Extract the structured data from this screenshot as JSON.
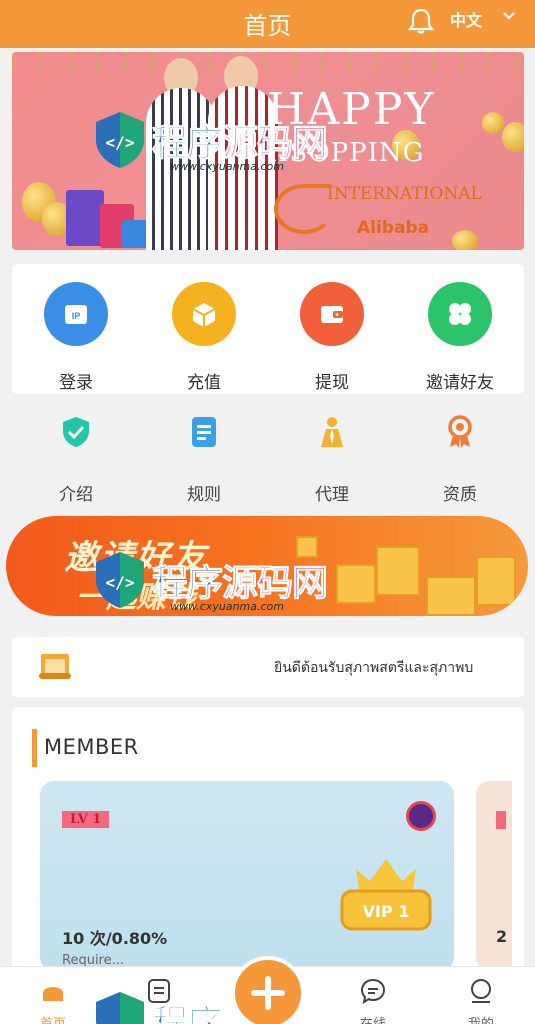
{
  "header": {
    "title": "首页",
    "language": "中文"
  },
  "banner": {
    "headline": "HAPPY",
    "subline": "IISOPPING",
    "international": "INTERNATIONAL",
    "brand": "Alibaba"
  },
  "main_actions": [
    {
      "label": "登录",
      "icon": "ip-icon",
      "color": "#3a8ee6"
    },
    {
      "label": "充值",
      "icon": "cube-icon",
      "color": "#f5b21e"
    },
    {
      "label": "提现",
      "icon": "wallet-icon",
      "color": "#f1603a"
    },
    {
      "label": "邀请好友",
      "icon": "clover-icon",
      "color": "#2bc46a"
    }
  ],
  "secondary_actions": [
    {
      "label": "介绍",
      "icon": "shield-check-icon"
    },
    {
      "label": "规则",
      "icon": "document-icon"
    },
    {
      "label": "代理",
      "icon": "agent-icon"
    },
    {
      "label": "资质",
      "icon": "award-icon"
    }
  ],
  "invite_banner": {
    "line1": "邀请好友",
    "line2": "一起赚钱"
  },
  "notice": {
    "message": "ยินดีต้อนรับสุภาพสตรีและสุภาพบ"
  },
  "member": {
    "title": "MEMBER",
    "cards": [
      {
        "tag": "LV 1",
        "badge": "VIP 1",
        "rate": "10 次/0.80%",
        "requirement": "Require..."
      },
      {
        "rate": "2"
      }
    ]
  },
  "tabbar": [
    {
      "label": "首页",
      "icon": "home-icon",
      "active": true
    },
    {
      "label": "",
      "icon": "list-icon"
    },
    {
      "label": "",
      "icon": "plus-icon"
    },
    {
      "label": "在线",
      "icon": "chat-icon"
    },
    {
      "label": "我的",
      "icon": "user-icon"
    }
  ],
  "watermark": {
    "text_part1": "程序",
    "text_part2": "源码网",
    "url": "www.cxyuanma.com"
  },
  "colors": {
    "primary": "#f5983a",
    "background": "#f1f1f1"
  }
}
